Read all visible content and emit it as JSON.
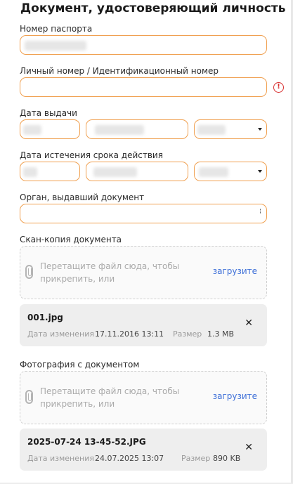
{
  "section": {
    "title": "Документ, удостоверяющий личность"
  },
  "passport": {
    "label": "Номер паспорта"
  },
  "personal_number": {
    "label": "Личный номер / Идентификационный номер",
    "info_icon": "alert-circle-icon"
  },
  "issue_date": {
    "label": "Дата выдачи"
  },
  "expiry_date": {
    "label": "Дата истечения срока действия"
  },
  "authority": {
    "label": "Орган, выдавший документ",
    "menu_glyph": "⁝"
  },
  "scan": {
    "label": "Скан-копия документа",
    "drop_text_line1": "Перетащите файл сюда, чтобы",
    "drop_text_line2": "прикрепить, или",
    "upload_label": "загрузите",
    "file": {
      "name": "001.jpg",
      "modified_label": "Дата изменения",
      "modified": "17.11.2016 13:11",
      "size_label": "Размер",
      "size": "1.3 MB",
      "remove_glyph": "✕"
    }
  },
  "photo": {
    "label": "Фотография с документом",
    "drop_text_line1": "Перетащите файл сюда, чтобы",
    "drop_text_line2": "прикрепить, или",
    "upload_label": "загрузите",
    "file": {
      "name": "2025-07-24 13-45-52.JPG",
      "modified_label": "Дата изменения",
      "modified": "24.07.2025 13:07",
      "size_label": "Размер",
      "size": "890 KB",
      "remove_glyph": "✕"
    }
  },
  "colors": {
    "field_border": "#f0a050",
    "link": "#3d6fd8",
    "error": "#d93030",
    "file_bg": "#eeeeee"
  }
}
